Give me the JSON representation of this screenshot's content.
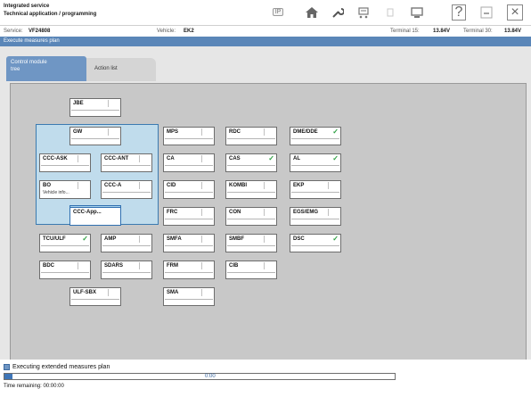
{
  "app": {
    "title_line1": "Integrated service",
    "title_line2": "Technical application / programming"
  },
  "toolbar": {
    "items": [
      {
        "name": "text-button",
        "text": "IP"
      },
      {
        "name": "home-icon"
      },
      {
        "name": "wrench-icon"
      },
      {
        "name": "cart-icon"
      },
      {
        "name": "blank-icon"
      },
      {
        "name": "monitor-icon"
      },
      {
        "name": "help-icon",
        "text": "?"
      },
      {
        "name": "minimize-icon"
      },
      {
        "name": "close-icon",
        "text": "×"
      }
    ]
  },
  "infobar": {
    "service_label": "Service:",
    "service_value": "VF24808",
    "vehicle_label": "Vehicle:",
    "vehicle_value": "EK2",
    "terminal15_label": "Terminal 15:",
    "terminal15_value": "13.84V",
    "terminal30_label": "Terminal 30:",
    "terminal30_value": "13.84V"
  },
  "section": {
    "title": "Execute measures plan"
  },
  "tabs": [
    {
      "line1": "Control module",
      "line2": "tree",
      "active": true
    },
    {
      "line1": "Action list",
      "line2": "",
      "active": false
    }
  ],
  "modules": [
    {
      "label": "JBE",
      "sub": "",
      "check": false
    },
    {
      "label": "GW",
      "sub": "",
      "check": false
    },
    {
      "label": "CCC-ASK",
      "sub": "",
      "check": false
    },
    {
      "label": "CCC-ANT",
      "sub": "",
      "check": false
    },
    {
      "label": "BO",
      "sub": "Vehicle info...",
      "check": false
    },
    {
      "label": "CCC-A",
      "sub": "",
      "check": false
    },
    {
      "label": "CCC-App...",
      "sub": "",
      "check": false
    },
    {
      "label": "TCU/ULF",
      "sub": "",
      "check": true
    },
    {
      "label": "AMP",
      "sub": "",
      "check": false
    },
    {
      "label": "BDC",
      "sub": "",
      "check": false
    },
    {
      "label": "SDARS",
      "sub": "",
      "check": false
    },
    {
      "label": "ULF-SBX",
      "sub": "",
      "check": false
    },
    {
      "label": "MPS",
      "sub": "",
      "check": false
    },
    {
      "label": "CA",
      "sub": "",
      "check": false
    },
    {
      "label": "CID",
      "sub": "",
      "check": false
    },
    {
      "label": "FRC",
      "sub": "",
      "check": false
    },
    {
      "label": "SMFA",
      "sub": "",
      "check": false
    },
    {
      "label": "FRM",
      "sub": "",
      "check": false
    },
    {
      "label": "SMA",
      "sub": "",
      "check": false
    },
    {
      "label": "RDC",
      "sub": "",
      "check": false
    },
    {
      "label": "CAS",
      "sub": "",
      "check": true
    },
    {
      "label": "KOMBI",
      "sub": "",
      "check": false
    },
    {
      "label": "CON",
      "sub": "",
      "check": false
    },
    {
      "label": "SMBF",
      "sub": "",
      "check": false
    },
    {
      "label": "CIB",
      "sub": "",
      "check": false
    },
    {
      "label": "DME/DDE",
      "sub": "",
      "check": true
    },
    {
      "label": "AL",
      "sub": "",
      "check": true
    },
    {
      "label": "EKP",
      "sub": "",
      "check": false
    },
    {
      "label": "EGS/EMG",
      "sub": "",
      "check": false
    },
    {
      "label": "DSC",
      "sub": "",
      "check": true
    }
  ],
  "footer": {
    "status_text": "Executing extended measures plan",
    "progress_fraction": 0.0045,
    "progress_label": "0:00",
    "time_label": "Time remaining:",
    "time_value": "00:00:00"
  }
}
